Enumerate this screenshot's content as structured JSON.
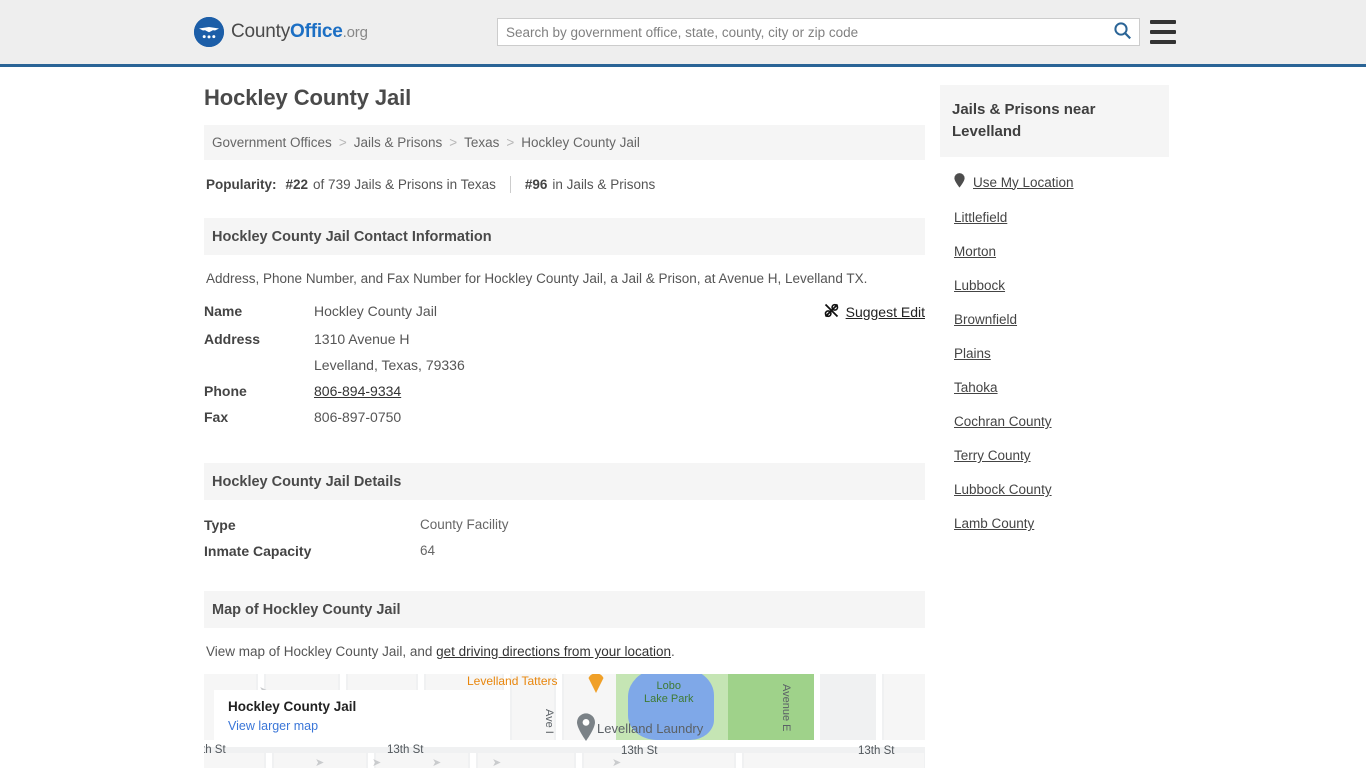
{
  "header": {
    "brand": {
      "part1": "County",
      "part2": "Office",
      "part3": ".org",
      "logo_icon": "eagle-shield-logo"
    },
    "search": {
      "placeholder": "Search by government office, state, county, city or zip code",
      "value": "",
      "search_icon": "search-icon",
      "accent_color": "#2a6496"
    },
    "menu_icon": "hamburger-menu-icon"
  },
  "page": {
    "title": "Hockley County Jail"
  },
  "breadcrumb": {
    "items": [
      {
        "label": "Government Offices"
      },
      {
        "label": "Jails & Prisons"
      },
      {
        "label": "Texas"
      },
      {
        "label": "Hockley County Jail"
      }
    ],
    "separator": ">"
  },
  "popularity": {
    "label": "Popularity:",
    "rank_state": "#22",
    "rank_state_text": "of 739 Jails & Prisons in Texas",
    "rank_national": "#96",
    "rank_national_text": "in Jails & Prisons"
  },
  "contact": {
    "heading": "Hockley County Jail Contact Information",
    "description": "Address, Phone Number, and Fax Number for Hockley County Jail, a Jail & Prison, at Avenue H, Levelland TX.",
    "suggest_edit": {
      "label": "Suggest Edit",
      "icon": "suggest-edit-icon"
    },
    "rows": [
      {
        "key": "Name",
        "value": "Hockley County Jail",
        "link": false
      },
      {
        "key": "Address",
        "value": "1310 Avenue H",
        "link": false
      },
      {
        "key": "",
        "value": "Levelland, Texas, 79336",
        "link": false
      },
      {
        "key": "Phone",
        "value": "806-894-9334",
        "link": true
      },
      {
        "key": "Fax",
        "value": "806-897-0750",
        "link": false
      }
    ]
  },
  "details": {
    "heading": "Hockley County Jail Details",
    "rows": [
      {
        "key": "Type",
        "value": "County Facility"
      },
      {
        "key": "Inmate Capacity",
        "value": "64"
      }
    ]
  },
  "map_section": {
    "heading": "Map of Hockley County Jail",
    "description_prefix": "View map of Hockley County Jail, and ",
    "description_link": "get driving directions from your location",
    "description_suffix": ".",
    "card": {
      "title": "Hockley County Jail",
      "link": "View larger map",
      "link_color": "#3a76d8"
    },
    "labels": {
      "poi_tatters": "Levelland Tatters",
      "park": "Lobo\nLake Park",
      "park_line1": "Lobo",
      "park_line2": "Lake Park",
      "poi_laundry": "Levelland Laundry",
      "street_ave_i": "Ave I",
      "street_avenue_e": "Avenue E",
      "street_13th_left": "th St",
      "street_13th_mid1": "13th St",
      "street_13th_mid2": "13th St",
      "street_13th_right": "13th St"
    },
    "marker_icon": "map-marker-icon",
    "poi_marker_icon": "map-poi-marker-icon"
  },
  "sidebar": {
    "heading": "Jails & Prisons near Levelland",
    "use_my_location": {
      "label": "Use My Location",
      "icon": "location-pin-icon"
    },
    "items": [
      {
        "label": "Littlefield"
      },
      {
        "label": "Morton"
      },
      {
        "label": "Lubbock"
      },
      {
        "label": "Brownfield"
      },
      {
        "label": "Plains"
      },
      {
        "label": "Tahoka"
      },
      {
        "label": "Cochran County"
      },
      {
        "label": "Terry County"
      },
      {
        "label": "Lubbock County"
      },
      {
        "label": "Lamb County"
      }
    ]
  }
}
